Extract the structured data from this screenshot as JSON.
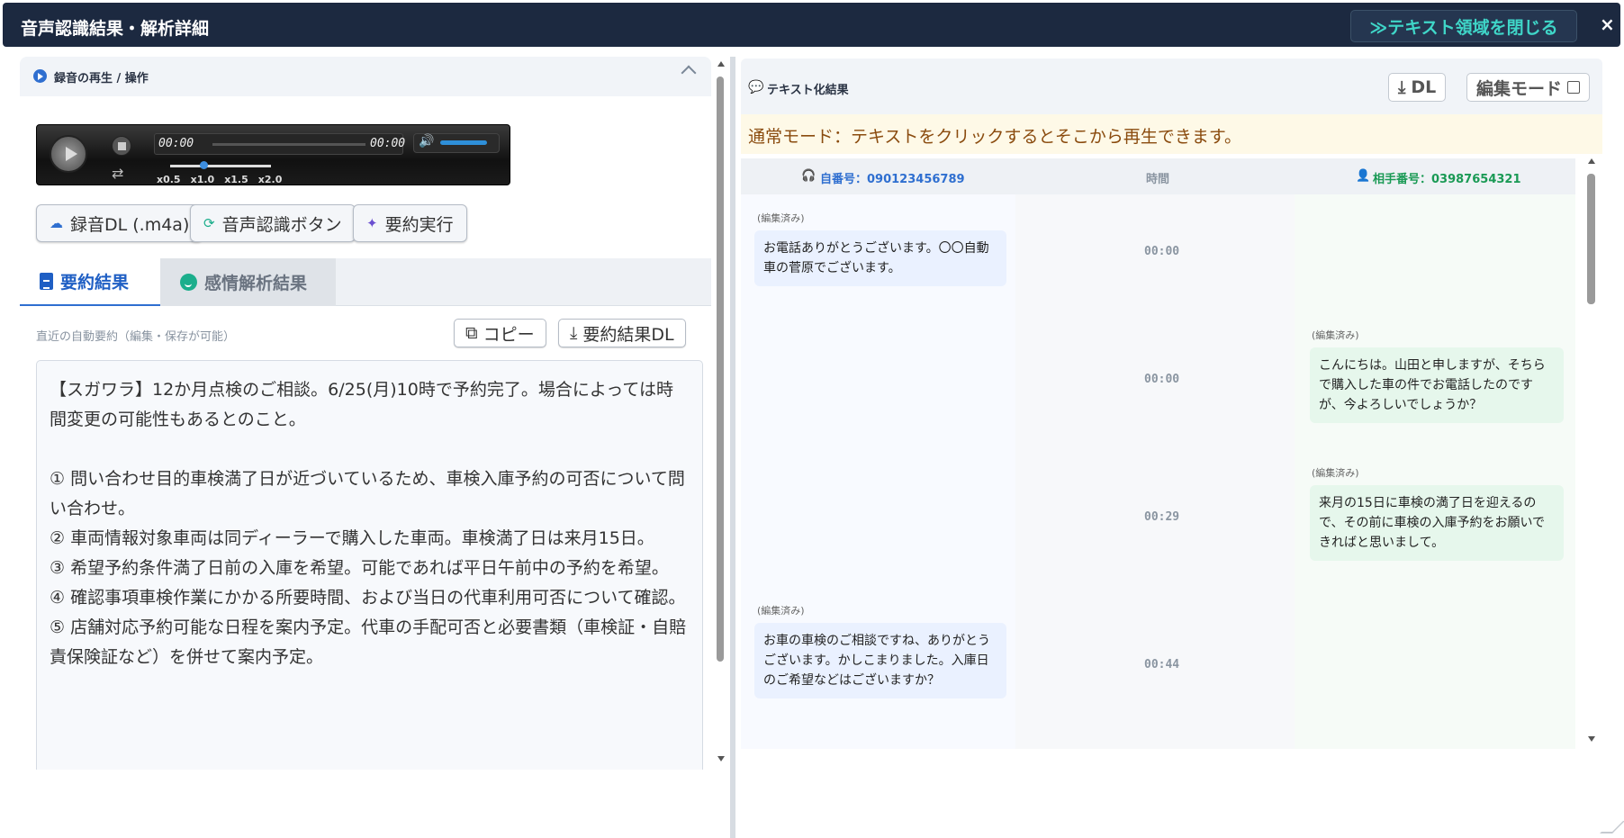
{
  "window": {
    "title": "音声認識結果・解析詳細",
    "close_text_area_label": "≫テキスト領域を閉じる",
    "close_symbol": "×"
  },
  "recording": {
    "section_title": "録音の再生 / 操作",
    "player": {
      "current_time": "00:00",
      "duration": "00:00",
      "speeds": [
        "x0.5",
        "x1.0",
        "x1.5",
        "x2.0"
      ],
      "selected_speed": "x1.0",
      "volume_level": 0.8
    },
    "buttons": {
      "download": "録音DL (.m4a)",
      "recognize": "音声認識ボタン",
      "summarize": "要約実行"
    }
  },
  "tabs": [
    {
      "label": "要約結果",
      "active": true
    },
    {
      "label": "感情解析結果",
      "active": false
    }
  ],
  "summary": {
    "auto_label": "直近の自動要約（編集・保存が可能）",
    "copy_label": "コピー",
    "download_label": "要約結果DL",
    "text": "【スガワラ】12か月点検のご相談。6/25(月)10時で予約完了。場合によっては時間変更の可能性もあるとのこと。\n\n① 問い合わせ目的車検満了日が近づいているため、車検入庫予約の可否について問い合わせ。\n② 車両情報対象車両は同ディーラーで購入した車両。車検満了日は来月15日。\n③ 希望予約条件満了日前の入庫を希望。可能であれば平日午前中の予約を希望。\n④ 確認事項車検作業にかかる所要時間、および当日の代車利用可否について確認。\n⑤ 店舗対応予約可能な日程を案内予定。代車の手配可否と必要書類（車検証・自賠責保険証など）を併せて案内予定。"
  },
  "transcript": {
    "section_title": "テキスト化結果",
    "dl_label": "DL",
    "edit_mode_label": "編集モード",
    "notice": "通常モード：テキストをクリックするとそこから再生できます。",
    "headers": {
      "own_number": "自番号：090123456789",
      "time": "時間",
      "other_number": "相手番号：03987654321"
    },
    "messages": [
      {
        "side": "left",
        "edited": "(編集済み)",
        "time": "00:00",
        "text": "お電話ありがとうございます。〇〇自動車の菅原でございます。"
      },
      {
        "side": "right",
        "edited": "(編集済み)",
        "time": "00:00",
        "text": "こんにちは。山田と申しますが、そちらで購入した車の件でお電話したのですが、今よろしいでしょうか？"
      },
      {
        "side": "right",
        "edited": "(編集済み)",
        "time": "00:29",
        "text": "来月の15日に車検の満了日を迎えるので、その前に車検の入庫予約をお願いできればと思いまして。"
      },
      {
        "side": "left",
        "edited": "(編集済み)",
        "time": "00:44",
        "text": "お車の車検のご相談ですね、ありがとうございます。かしこまりました。入庫日のご希望などはございますか？"
      }
    ]
  },
  "colors": {
    "titlebar": "#1c2940",
    "accent_blue": "#2f6fd0",
    "accent_teal": "#3fd6c8",
    "notice_bg": "#fef9e7",
    "other_green": "#1a9a55"
  }
}
